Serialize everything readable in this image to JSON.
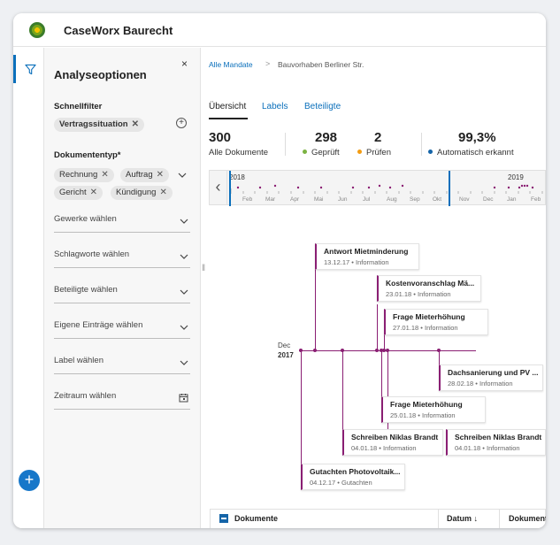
{
  "app": {
    "title": "CaseWorx Baurecht"
  },
  "rail": {
    "filter_icon": "filter-icon",
    "add_icon": "plus-icon",
    "add_label": "+"
  },
  "panel": {
    "close_label": "×",
    "title": "Analyseoptionen",
    "schnellfilter": {
      "label": "Schnellfilter",
      "chips": [
        "Vertragssituation"
      ],
      "add_label": "+"
    },
    "dokumententyp": {
      "label": "Dokumententyp*",
      "chips": [
        "Rechnung",
        "Auftrag",
        "Gericht",
        "Kündigung"
      ]
    },
    "dropdowns": [
      "Gewerke wählen",
      "Schlagworte wählen",
      "Beteiligte wählen",
      "Eigene Einträge wählen",
      "Label wählen",
      "Zeitraum wählen"
    ]
  },
  "main": {
    "breadcrumb": {
      "link": "Alle Mandate",
      "separator": ">",
      "current": "Bauvorhaben Berliner Str."
    },
    "tabs": [
      "Übersicht",
      "Labels",
      "Beteiligte"
    ],
    "stats": [
      {
        "value": "300",
        "label": "Alle Dokumente",
        "color": ""
      },
      {
        "value": "298",
        "label": "Geprüft",
        "color": "#7cb342"
      },
      {
        "value": "2",
        "label": "Prüfen",
        "color": "#f39c12"
      },
      {
        "value": "99,3%",
        "label": "Automatisch erkannt",
        "color": "#1565a8"
      }
    ],
    "timeline_nav": {
      "years": [
        "2018",
        "2019"
      ],
      "months": [
        "Feb",
        "Mar",
        "Apr",
        "Mai",
        "Jun",
        "Jul",
        "Aug",
        "Sep",
        "Okt",
        "Nov",
        "Dec",
        "Jan",
        "Feb"
      ],
      "prev_label": "‹"
    },
    "timeline": {
      "axis_month": "Dec",
      "axis_year": "2017",
      "accent": "#8a1e73",
      "cards": [
        {
          "title": "Antwort Mietminderung",
          "date": "13.12.17",
          "type": "Information"
        },
        {
          "title": "Kostenvoranschlag Mä...",
          "date": "23.01.18",
          "type": "Information"
        },
        {
          "title": "Frage Mieterhöhung",
          "date": "27.01.18",
          "type": "Information"
        },
        {
          "title": "Dachsanierung und PV ...",
          "date": "28.02.18",
          "type": "Information"
        },
        {
          "title": "Frage Mieterhöhung",
          "date": "25.01.18",
          "type": "Information"
        },
        {
          "title": "Schreiben  Niklas Brandt",
          "date": "04.01.18",
          "type": "Information"
        },
        {
          "title": "Schreiben  Niklas Brandt",
          "date": "04.01.18",
          "type": "Information"
        },
        {
          "title": "Gutachten Photovoltaik...",
          "date": "04.12.17",
          "type": "Gutachten"
        }
      ],
      "separator": "•"
    },
    "table": {
      "columns": [
        "Dokumente",
        "Datum",
        "Dokumententyp"
      ],
      "sort_icon": "↓"
    }
  }
}
